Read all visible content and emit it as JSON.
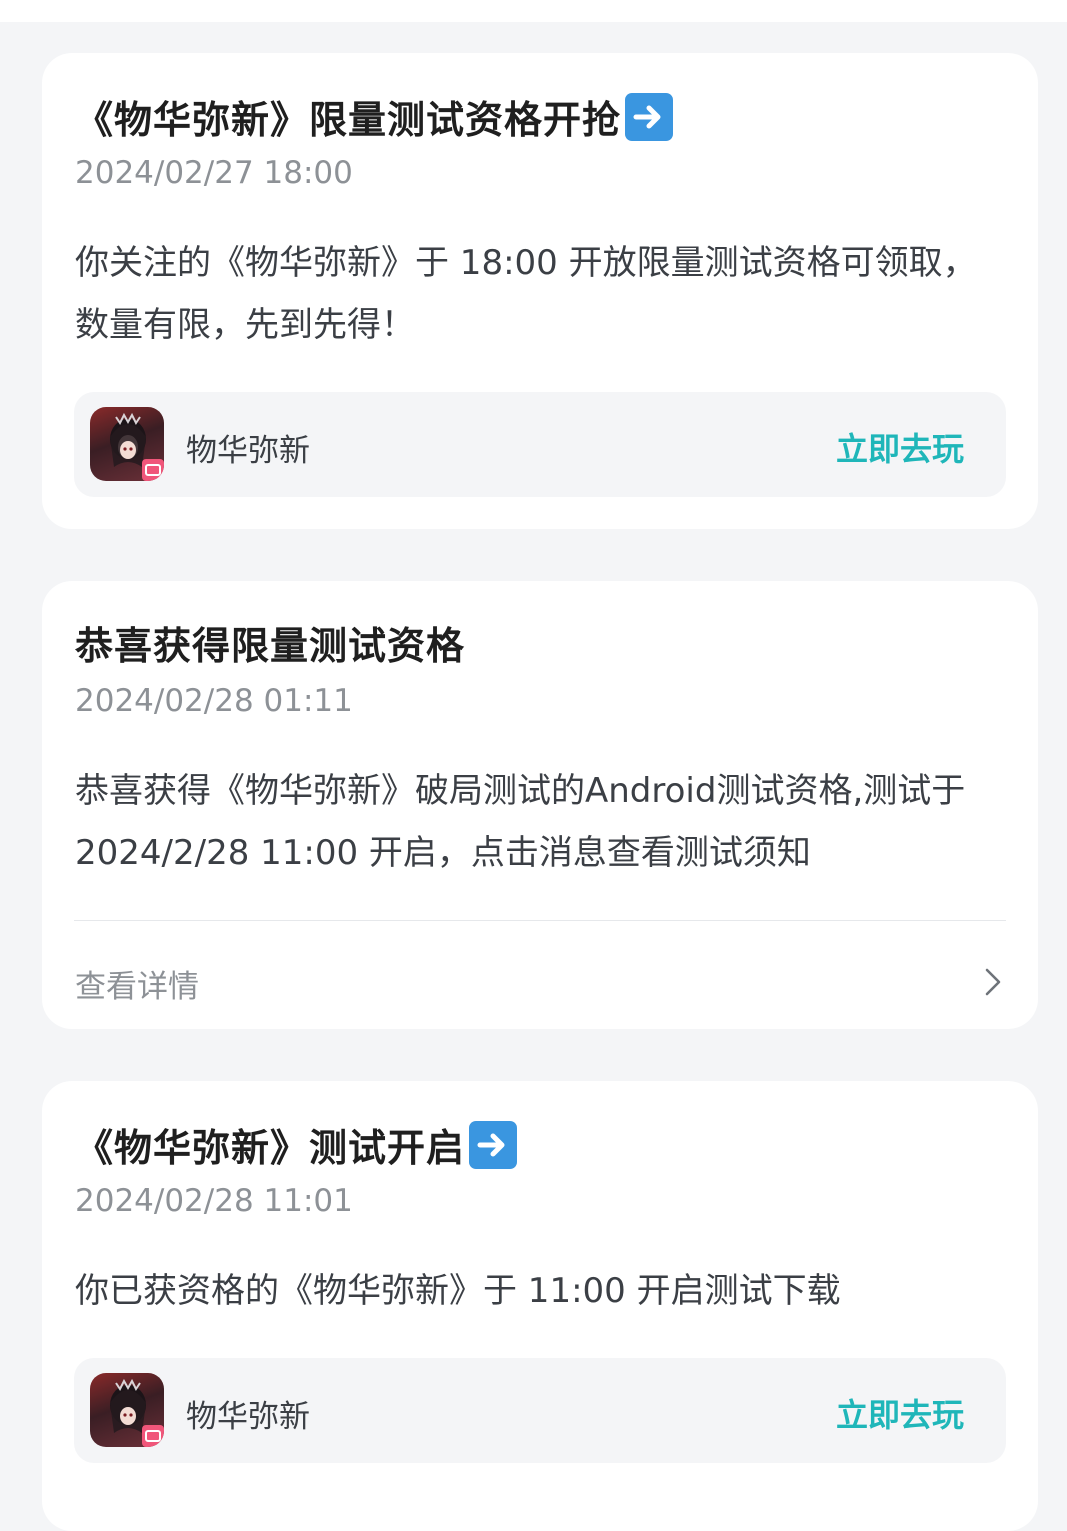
{
  "cards": [
    {
      "title": "《物华弥新》限量测试资格开抢",
      "title_icon": "arrow-right-emoji",
      "time": "2024/02/27 18:00",
      "body": "你关注的《物华弥新》于 18:00 开放限量测试资格可领取，数量有限，先到先得！",
      "app": {
        "name": "物华弥新",
        "action": "立即去玩"
      }
    },
    {
      "title": "恭喜获得限量测试资格",
      "time": "2024/02/28 01:11",
      "body": "恭喜获得《物华弥新》破局测试的Android测试资格,测试于 2024/2/28 11:00 开启，点击消息查看测试须知",
      "detail": {
        "label": "查看详情",
        "icon": "chevron-right-icon"
      }
    },
    {
      "title": "《物华弥新》测试开启",
      "title_icon": "arrow-right-emoji",
      "time": "2024/02/28 11:01",
      "body": "你已获资格的《物华弥新》于 11:00 开启测试下载",
      "app": {
        "name": "物华弥新",
        "action": "立即去玩"
      }
    }
  ],
  "colors": {
    "background": "#f4f5f7",
    "card": "#ffffff",
    "accent": "#1fb6b9",
    "muted_text": "#8d9196",
    "arrow_badge": "#3a96e0"
  }
}
